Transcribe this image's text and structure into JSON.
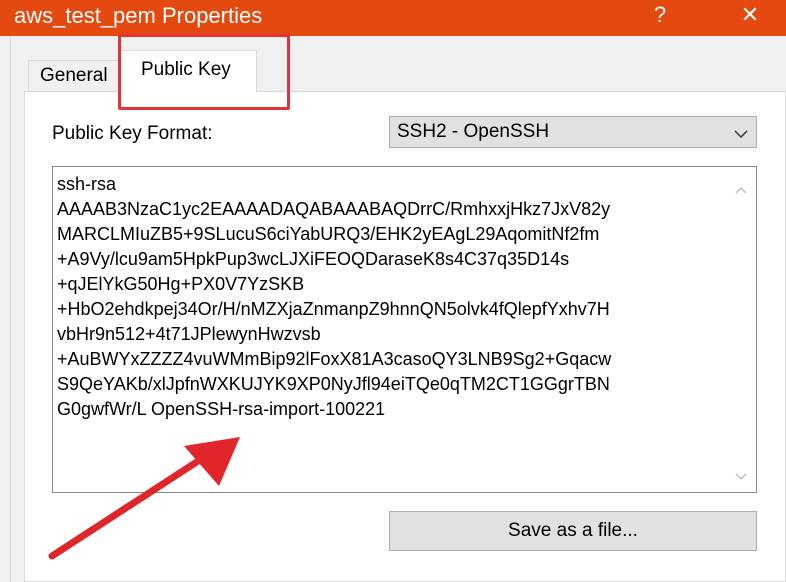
{
  "window": {
    "title": "aws_test_pem Properties",
    "help_label": "?",
    "close_label": "✕",
    "title_bar_color": "#e4490f"
  },
  "tabs": [
    {
      "label": "General",
      "active": false
    },
    {
      "label": "Public Key",
      "active": true
    }
  ],
  "public_key": {
    "format_label": "Public Key Format:",
    "format_value": "SSH2 - OpenSSH",
    "key_lines": [
      "ssh-rsa",
      "AAAAB3NzaC1yc2EAAAADAQABAAABAQDrrC/RmhxxjHkz7JxV82y",
      "MARCLMIuZB5+9SLucuS6ciYabURQ3/EHK2yEAgL29AqomitNf2fm",
      "+A9Vy/lcu9am5HpkPup3wcLJXiFEOQDaraseK8s4C37q35D14s",
      "+qJElYkG50Hg+PX0V7YzSKB",
      "+HbO2ehdkpej34Or/H/nMZXjaZnmanpZ9hnnQN5olvk4fQlepfYxhv7H",
      "vbHr9n512+4t71JPlewynHwzvsb",
      "+AuBWYxZZZZ4vuWMmBip92lFoxX81A3casoQY3LNB9Sg2+Gqacw",
      "S9QeYAKb/xlJpfnWXKUJYK9XP0NyJfl94eiTQe0qTM2CT1GGgrTBN",
      "G0gwfWr/L OpenSSH-rsa-import-100221"
    ],
    "save_label": "Save as a file..."
  },
  "annotation": {
    "highlight_color": "#e0333a",
    "arrow_color": "#e0262b"
  }
}
